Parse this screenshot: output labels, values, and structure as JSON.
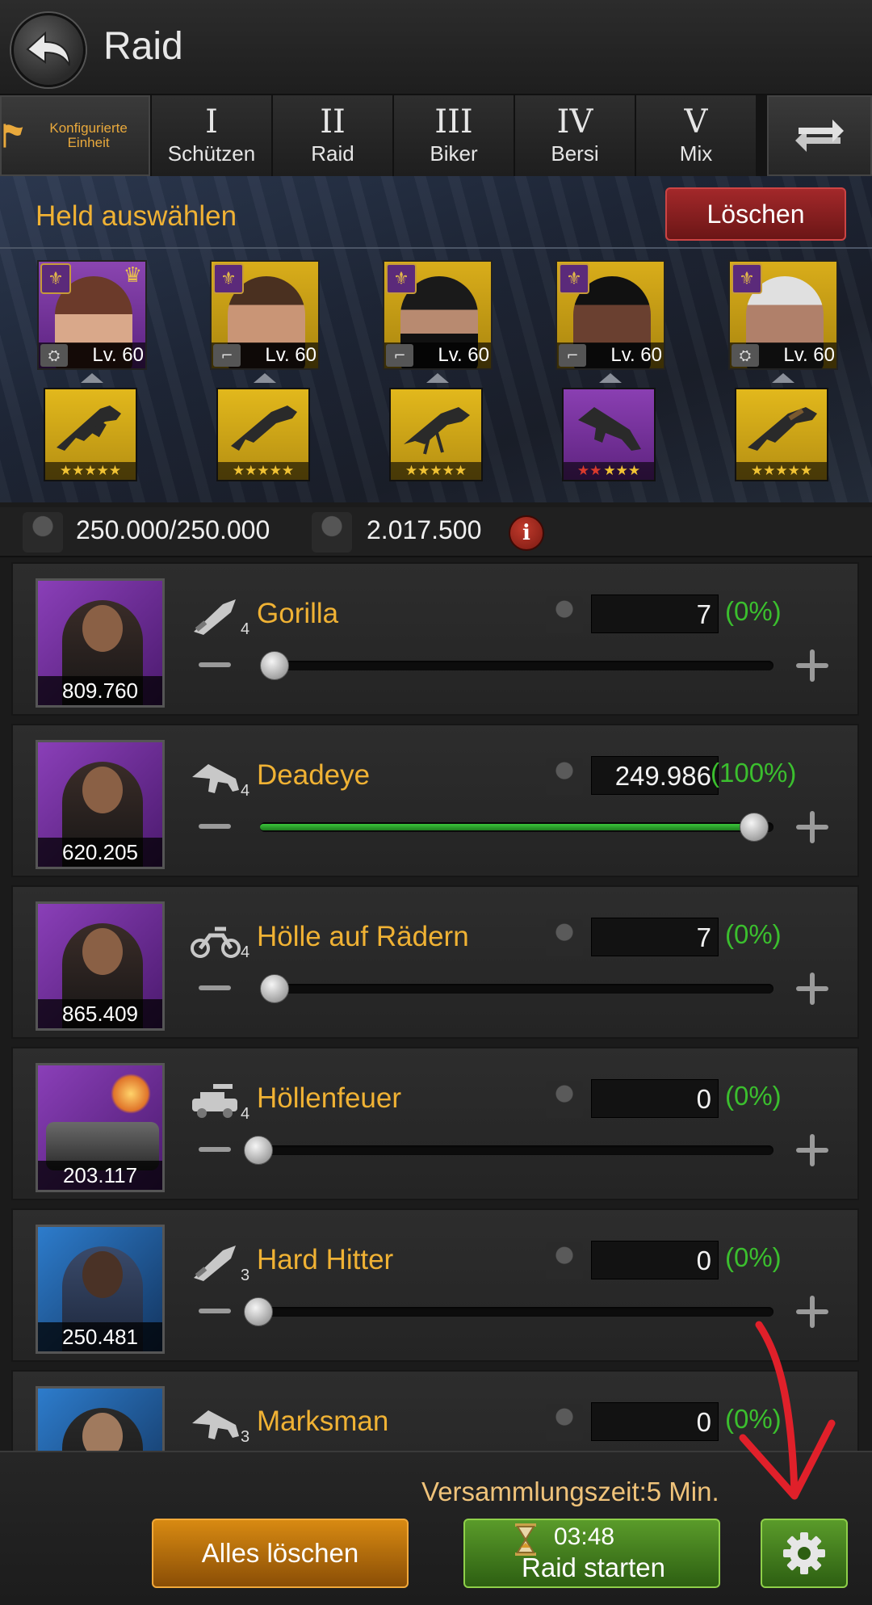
{
  "header": {
    "title": "Raid",
    "back_icon": "back-arrow-icon"
  },
  "tabs": {
    "config_label": "Konfigurierte Einheit",
    "items": [
      {
        "num": "I",
        "name": "Schützen"
      },
      {
        "num": "II",
        "name": "Raid"
      },
      {
        "num": "III",
        "name": "Biker"
      },
      {
        "num": "IV",
        "name": "Bersi"
      },
      {
        "num": "V",
        "name": "Mix"
      }
    ],
    "swap_icon": "swap-arrows-icon"
  },
  "heroes": {
    "title": "Held auswählen",
    "clear_label": "Löschen",
    "items": [
      {
        "level": "Lv. 60",
        "rarity": "purple",
        "crown": true
      },
      {
        "level": "Lv. 60",
        "rarity": "gold",
        "crown": false
      },
      {
        "level": "Lv. 60",
        "rarity": "gold",
        "crown": false
      },
      {
        "level": "Lv. 60",
        "rarity": "gold",
        "crown": false
      },
      {
        "level": "Lv. 60",
        "rarity": "gold",
        "crown": false
      }
    ],
    "weapons": [
      {
        "rarity": "gold",
        "stars_gold": 5,
        "stars_red": 0
      },
      {
        "rarity": "gold",
        "stars_gold": 5,
        "stars_red": 0
      },
      {
        "rarity": "gold",
        "stars_gold": 5,
        "stars_red": 0
      },
      {
        "rarity": "purple",
        "stars_gold": 3,
        "stars_red": 2
      },
      {
        "rarity": "gold",
        "stars_gold": 5,
        "stars_red": 0
      }
    ]
  },
  "stats": {
    "capacity": "250.000/250.000",
    "power": "2.017.500",
    "info_icon": "info-icon"
  },
  "units": [
    {
      "name": "Gorilla",
      "tier": "4",
      "type": "knife",
      "power": "809.760",
      "count": "7",
      "pct": "(0%)",
      "fill": 0.0,
      "thumb": "purple"
    },
    {
      "name": "Deadeye",
      "tier": "4",
      "type": "gun",
      "power": "620.205",
      "count": "249.986",
      "pct": "(100%)",
      "fill": 1.0,
      "thumb": "purple"
    },
    {
      "name": "Hölle auf Rädern",
      "tier": "4",
      "type": "bike",
      "power": "865.409",
      "count": "7",
      "pct": "(0%)",
      "fill": 0.0,
      "thumb": "purple"
    },
    {
      "name": "Höllenfeuer",
      "tier": "4",
      "type": "truck",
      "power": "203.117",
      "count": "0",
      "pct": "(0%)",
      "fill": 0.0,
      "thumb": "purple"
    },
    {
      "name": "Hard Hitter",
      "tier": "3",
      "type": "knife",
      "power": "250.481",
      "count": "0",
      "pct": "(0%)",
      "fill": 0.0,
      "thumb": "blue"
    },
    {
      "name": "Marksman",
      "tier": "3",
      "type": "gun",
      "power": "",
      "count": "0",
      "pct": "(0%)",
      "fill": 0.0,
      "thumb": "blue"
    }
  ],
  "footer": {
    "assembly_label": "Versammlungszeit:5 Min.",
    "clear_all_label": "Alles löschen",
    "timer": "03:48",
    "start_label": "Raid starten",
    "settings_icon": "gear-icon"
  },
  "colors": {
    "accent_gold": "#f0b234",
    "green": "#3bbf2e",
    "red_button": "#a3282a"
  }
}
